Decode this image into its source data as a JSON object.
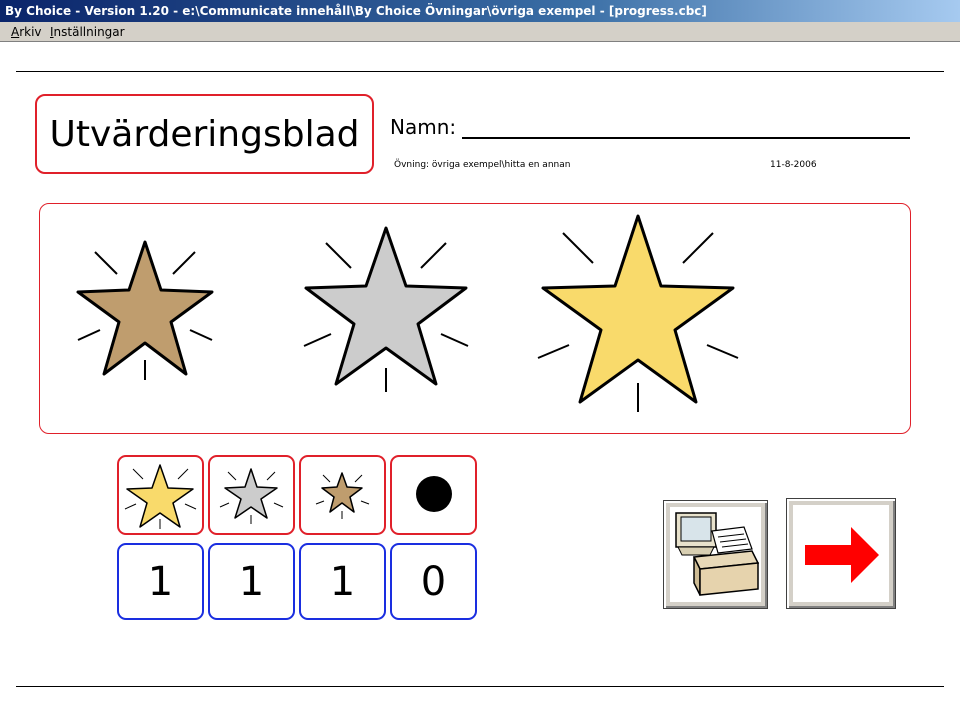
{
  "window": {
    "title": "By Choice - Version 1.20 - e:\\Communicate innehåll\\By Choice Övningar\\övriga exempel - [progress.cbc]"
  },
  "menu": {
    "items": [
      {
        "label": "Arkiv"
      },
      {
        "label": "Inställningar"
      }
    ]
  },
  "header": {
    "title": "Utvärderingsblad",
    "name_label": "Namn:",
    "exercise_text": "Övning: övriga exempel\\hitta en annan",
    "date_text": "11-8-2006"
  },
  "colors": {
    "accent_red": "#e0202a",
    "accent_blue": "#1a2ee0",
    "star_bronze": "#bf9d6e",
    "star_silver": "#cccccc",
    "star_gold": "#f9da6b",
    "arrow_red": "#ff0000"
  },
  "results": {
    "categories": [
      {
        "icon": "gold-star-icon",
        "count": "1"
      },
      {
        "icon": "silver-star-icon",
        "count": "1"
      },
      {
        "icon": "bronze-star-icon",
        "count": "1"
      },
      {
        "icon": "black-dot-icon",
        "count": "0"
      }
    ]
  },
  "actions": {
    "print_icon": "printer-icon",
    "next_icon": "right-arrow-icon"
  }
}
